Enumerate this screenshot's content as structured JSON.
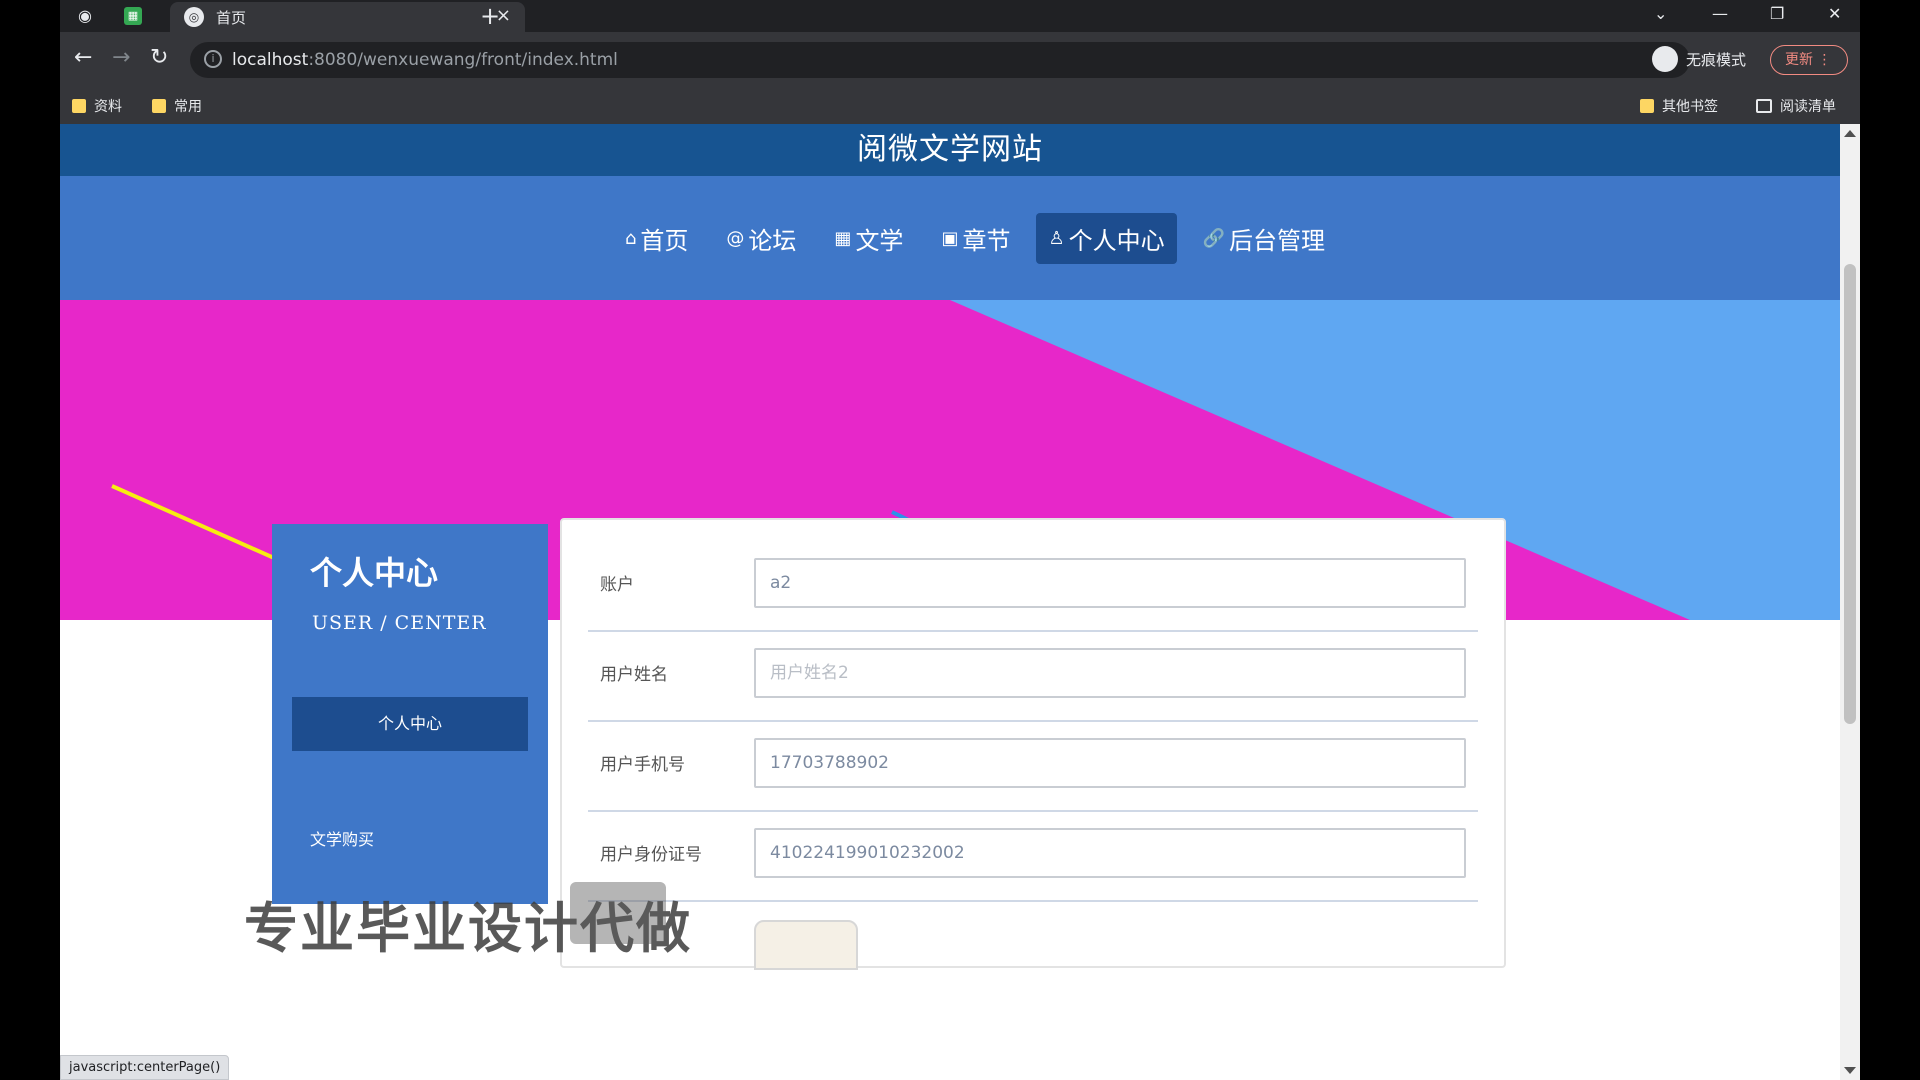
{
  "browser": {
    "tab_title": "首页",
    "tab_close": "×",
    "new_tab": "+",
    "url_host": "localhost",
    "url_path": ":8080/wenxuewang/front/index.html",
    "profile_label": "无痕模式",
    "update_label": "更新",
    "bookmarks": [
      {
        "label": "资料"
      },
      {
        "label": "常用"
      }
    ],
    "other_bookmarks": "其他书签",
    "reading_list": "阅读清单",
    "status_url": "javascript:centerPage()"
  },
  "site": {
    "title": "阅微文学网站",
    "nav": [
      {
        "label": "首页",
        "icon": "home-icon"
      },
      {
        "label": "论坛",
        "icon": "at-icon"
      },
      {
        "label": "文学",
        "icon": "grid-icon"
      },
      {
        "label": "章节",
        "icon": "image-icon"
      },
      {
        "label": "个人中心",
        "icon": "user-icon",
        "active": true
      },
      {
        "label": "后台管理",
        "icon": "link-icon"
      }
    ],
    "banner_colors": {
      "primary": "#e727c9",
      "secondary": "#5fa7f2",
      "arrow_yellow": "#f7ec12",
      "arrow_blue": "#2b93e8"
    }
  },
  "user_center": {
    "title": "个人中心",
    "subtitle": "USER / CENTER",
    "menu_active": "个人中心",
    "menu_item_2": "文学购买"
  },
  "form": {
    "fields": [
      {
        "label": "账户",
        "value": "a2"
      },
      {
        "label": "用户姓名",
        "value": "",
        "placeholder": "用户姓名2"
      },
      {
        "label": "用户手机号",
        "value": "17703788902"
      },
      {
        "label": "用户身份证号",
        "value": "410224199010232002"
      }
    ]
  },
  "watermark": "专业毕业设计代做"
}
